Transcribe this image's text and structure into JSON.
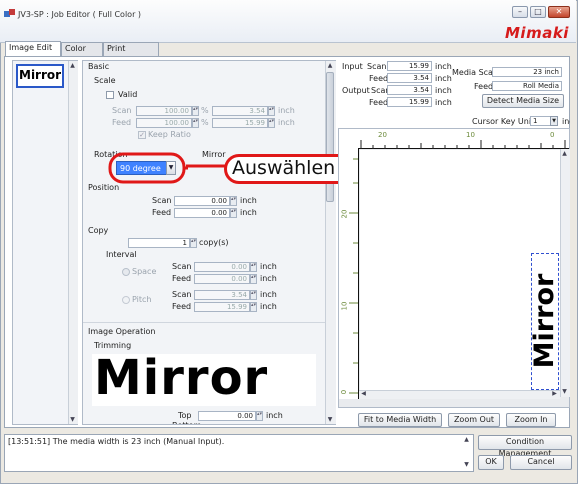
{
  "window": {
    "title": "JV3-SP : Job Editor ( Full Color )",
    "brand": "Mimaki",
    "controls": [
      "minimize",
      "maximize",
      "close"
    ]
  },
  "tabs": [
    {
      "label": "Image Edit",
      "active": true
    },
    {
      "label": "Color Edit"
    },
    {
      "label": "Print Condition"
    }
  ],
  "thumbnail": {
    "text": "Mirror"
  },
  "basic": {
    "section": "Basic",
    "scale": "Scale",
    "valid": "Valid",
    "scan_label": "Scan",
    "scan_value": "100.00",
    "scan_pct": "%",
    "scan_inch_value": "3.54",
    "scan_unit": "inch",
    "feed_label": "Feed",
    "feed_value": "100.00",
    "feed_pct": "%",
    "feed_inch_value": "15.99",
    "feed_unit": "inch",
    "keep_ratio": "Keep Ratio",
    "rotation": "Rotation",
    "rotation_value": "90 degree",
    "mirror": "Mirror",
    "callout": "Auswählen",
    "position": "Position",
    "pos_scan_label": "Scan",
    "pos_scan_value": "0.00",
    "pos_scan_unit": "inch",
    "pos_feed_label": "Feed",
    "pos_feed_value": "0.00",
    "pos_feed_unit": "inch",
    "copy": "Copy",
    "copy_value": "1",
    "copy_unit": "copy(s)",
    "interval": "Interval",
    "space": "Space",
    "sp_scan_label": "Scan",
    "sp_scan_value": "0.00",
    "sp_scan_unit": "inch",
    "sp_feed_label": "Feed",
    "sp_feed_value": "0.00",
    "sp_feed_unit": "inch",
    "pitch": "Pitch",
    "pi_scan_label": "Scan",
    "pi_scan_value": "3.54",
    "pi_scan_unit": "inch",
    "pi_feed_label": "Feed",
    "pi_feed_value": "15.99",
    "pi_feed_unit": "inch",
    "image_operation": "Image Operation",
    "trimming": "Trimming",
    "preview_text": "Mirror",
    "top_label": "Top",
    "top_value": "0.00",
    "top_unit": "inch",
    "bottom_label": "Bottom"
  },
  "info": {
    "input": "Input",
    "in_scan": "Scan",
    "in_scan_value": "15.99",
    "in_scan_unit": "inch",
    "in_feed": "Feed",
    "in_feed_value": "3.54",
    "in_feed_unit": "inch",
    "output": "Output",
    "out_scan": "Scan",
    "out_scan_value": "3.54",
    "out_scan_unit": "inch",
    "out_feed": "Feed",
    "out_feed_value": "15.99",
    "out_feed_unit": "inch",
    "media_scan": "Media Scan",
    "media_scan_value": "23 inch",
    "media_feed": "Feed",
    "media_feed_value": "Roll Media",
    "detect_button": "Detect Media Size",
    "cursor_key_unit": "Cursor Key Unit",
    "cursor_key_value": "1",
    "cursor_key_unit_suffix": "inch",
    "ruler_top": [
      "20",
      "10",
      "0"
    ],
    "ruler_left": [
      "20",
      "10",
      "0"
    ],
    "canvas_text": "Mirror"
  },
  "canvas_buttons": {
    "fit": "Fit to Media Width",
    "zoom_out": "Zoom Out",
    "zoom_in": "Zoom In"
  },
  "status": {
    "message": "[13:51:51] The media width is 23 inch (Manual Input)."
  },
  "footer": {
    "condition": "Condition Management",
    "ok": "OK",
    "cancel": "Cancel"
  }
}
